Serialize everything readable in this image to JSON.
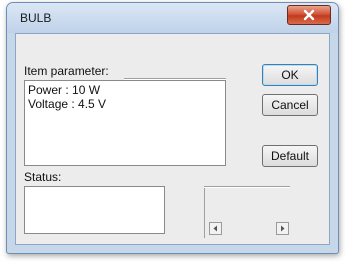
{
  "window": {
    "title": "BULB"
  },
  "item_parameter": {
    "label": "Item parameter:",
    "lines": [
      "Power : 10 W",
      "Voltage : 4.5 V"
    ]
  },
  "buttons": {
    "ok": "OK",
    "cancel": "Cancel",
    "default": "Default"
  },
  "status": {
    "label": "Status:"
  },
  "icons": {
    "close": "close-icon",
    "scroll_left": "scroll-left-arrow-icon",
    "scroll_right": "scroll-right-arrow-icon"
  },
  "colors": {
    "close_button": "#c8492b",
    "title_bar": "#c7d7ea"
  }
}
